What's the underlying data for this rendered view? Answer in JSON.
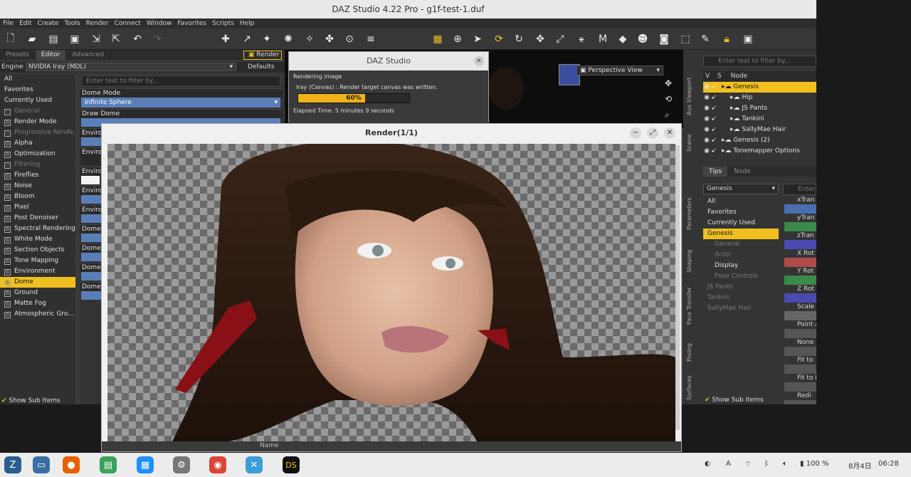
{
  "window": {
    "title": "DAZ Studio 4.22 Pro - g1f-test-1.duf"
  },
  "menu": [
    "File",
    "Edit",
    "Create",
    "Tools",
    "Render",
    "Connect",
    "Window",
    "Favorites",
    "Scripts",
    "Help"
  ],
  "left_tabs": [
    "Presets",
    "Editor",
    "Advanced"
  ],
  "render_button": "Render",
  "engine": {
    "label": "Engine :",
    "value": "NVIDIA Iray (MDL)",
    "defaults": "Defaults"
  },
  "filter_placeholder": "Enter text to filter by...",
  "settings_groups": [
    {
      "label": "All",
      "state": "normal"
    },
    {
      "label": "Favorites",
      "state": "normal"
    },
    {
      "label": "Currently Used",
      "state": "normal"
    },
    {
      "label": "General",
      "state": "dim"
    },
    {
      "label": "Render Mode",
      "state": "normal"
    },
    {
      "label": "Progressive Rende...",
      "state": "dim"
    },
    {
      "label": "Alpha",
      "state": "normal"
    },
    {
      "label": "Optimization",
      "state": "normal"
    },
    {
      "label": "Filtering",
      "state": "dim"
    },
    {
      "label": "Fireflies",
      "state": "normal"
    },
    {
      "label": "Noise",
      "state": "normal"
    },
    {
      "label": "Bloom",
      "state": "normal"
    },
    {
      "label": "Pixel",
      "state": "normal"
    },
    {
      "label": "Post Denoiser",
      "state": "normal"
    },
    {
      "label": "Spectral Rendering",
      "state": "normal"
    },
    {
      "label": "White Mode",
      "state": "normal"
    },
    {
      "label": "Section Objects",
      "state": "normal"
    },
    {
      "label": "Tone Mapping",
      "state": "normal"
    },
    {
      "label": "Environment",
      "state": "normal"
    },
    {
      "label": "Dome",
      "state": "sel"
    },
    {
      "label": "Ground",
      "state": "normal"
    },
    {
      "label": "Matte Fog",
      "state": "normal"
    },
    {
      "label": "Atmospheric Gro...",
      "state": "normal"
    }
  ],
  "props": {
    "dome_mode_label": "Dome Mode",
    "dome_mode_value": "Infinite Sphere",
    "draw_dome_label": "Draw Dome",
    "envir_labels": [
      "Environ",
      "Environ",
      "Environ",
      "Environ",
      "Environ"
    ],
    "dome_labels": [
      "Dome",
      "Dome",
      "Dome",
      "Dome"
    ]
  },
  "show_sub_items": "Show Sub Items",
  "viewport": {
    "view": "Perspective View"
  },
  "progress": {
    "title": "DAZ Studio",
    "status": "Rendering image",
    "message": "Iray (Canvas) : Render target canvas was written.",
    "percent_text": "60%",
    "percent": 0.6,
    "elapsed": "Elapsed Time:  5 minutes 9 seconds"
  },
  "render_window": {
    "title": "Render(1/1)",
    "name_label": "Name"
  },
  "scene": {
    "filter_placeholder": "Enter text to filter by...",
    "header_v": "V",
    "header_s": "S",
    "header_node": "Node",
    "rows": [
      {
        "label": "Genesis",
        "indent": 0,
        "sel": true
      },
      {
        "label": "Hip",
        "indent": 1,
        "sel": false
      },
      {
        "label": "JS Pants",
        "indent": 1,
        "sel": false
      },
      {
        "label": "Tankini",
        "indent": 1,
        "sel": false
      },
      {
        "label": "SallyMae Hair",
        "indent": 1,
        "sel": false
      },
      {
        "label": "Genesis (2)",
        "indent": 0,
        "sel": false
      },
      {
        "label": "Tonemapper Options",
        "indent": 0,
        "sel": false
      }
    ],
    "side_tabs": [
      "Aux Viewport",
      "Scene"
    ]
  },
  "params": {
    "tabs": [
      "Tips",
      "Node"
    ],
    "node_select": "Genesis",
    "filter_placeholder": "Enter",
    "groups": [
      {
        "label": "All",
        "state": "normal",
        "indent": 0
      },
      {
        "label": "Favorites",
        "state": "normal",
        "indent": 0
      },
      {
        "label": "Currently Used",
        "state": "normal",
        "indent": 0
      },
      {
        "label": "Genesis",
        "state": "sel",
        "indent": 0
      },
      {
        "label": "General",
        "state": "dim",
        "indent": 1
      },
      {
        "label": "Actor",
        "state": "dim",
        "indent": 1
      },
      {
        "label": "Display",
        "state": "normal",
        "indent": 1
      },
      {
        "label": "Pose Controls",
        "state": "dim",
        "indent": 1
      },
      {
        "label": "JS Pants",
        "state": "dim",
        "indent": 0
      },
      {
        "label": "Tankini",
        "state": "dim",
        "indent": 0
      },
      {
        "label": "SallyMae Hair",
        "state": "dim",
        "indent": 0
      }
    ],
    "sliders": [
      "xTran",
      "yTran",
      "zTran",
      "X Rot",
      "Y Rot",
      "Z Rot",
      "Scale",
      "Point A",
      "None",
      "Fit to",
      "Fit to M",
      "Redi"
    ],
    "side_tabs": [
      "Parameters",
      "Shaping",
      "Face Transfer",
      "Posing",
      "Surfaces"
    ],
    "show_sub_items": "Show Sub Items"
  },
  "taskbar": {
    "lang": "A",
    "battery": "100 %",
    "date": "8月4日",
    "time": "06:28"
  }
}
